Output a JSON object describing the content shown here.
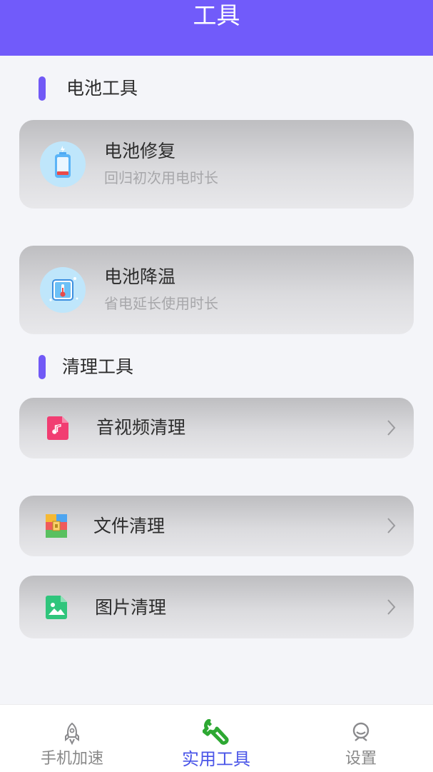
{
  "header": {
    "title": "工具"
  },
  "battery_section": {
    "title": "电池工具",
    "items": [
      {
        "title": "电池修复",
        "subtitle": "回归初次用电时长",
        "icon": "battery-repair-icon"
      },
      {
        "title": "电池降温",
        "subtitle": "省电延长使用时长",
        "icon": "thermometer-cool-icon"
      }
    ]
  },
  "clean_section": {
    "title": "清理工具",
    "items": [
      {
        "label": "音视频清理",
        "icon": "music-file-icon"
      },
      {
        "label": "文件清理",
        "icon": "archive-file-icon"
      },
      {
        "label": "图片清理",
        "icon": "image-file-icon"
      }
    ]
  },
  "bottom_nav": {
    "items": [
      {
        "label": "手机加速",
        "icon": "rocket-icon",
        "active": false
      },
      {
        "label": "实用工具",
        "icon": "wrench-icon",
        "active": true
      },
      {
        "label": "设置",
        "icon": "profile-icon",
        "active": false
      }
    ]
  },
  "colors": {
    "header_bg": "#715bfa",
    "accent_bar": "#7159f6",
    "active_nav": "#4a55e8",
    "active_icon": "#2da832"
  }
}
